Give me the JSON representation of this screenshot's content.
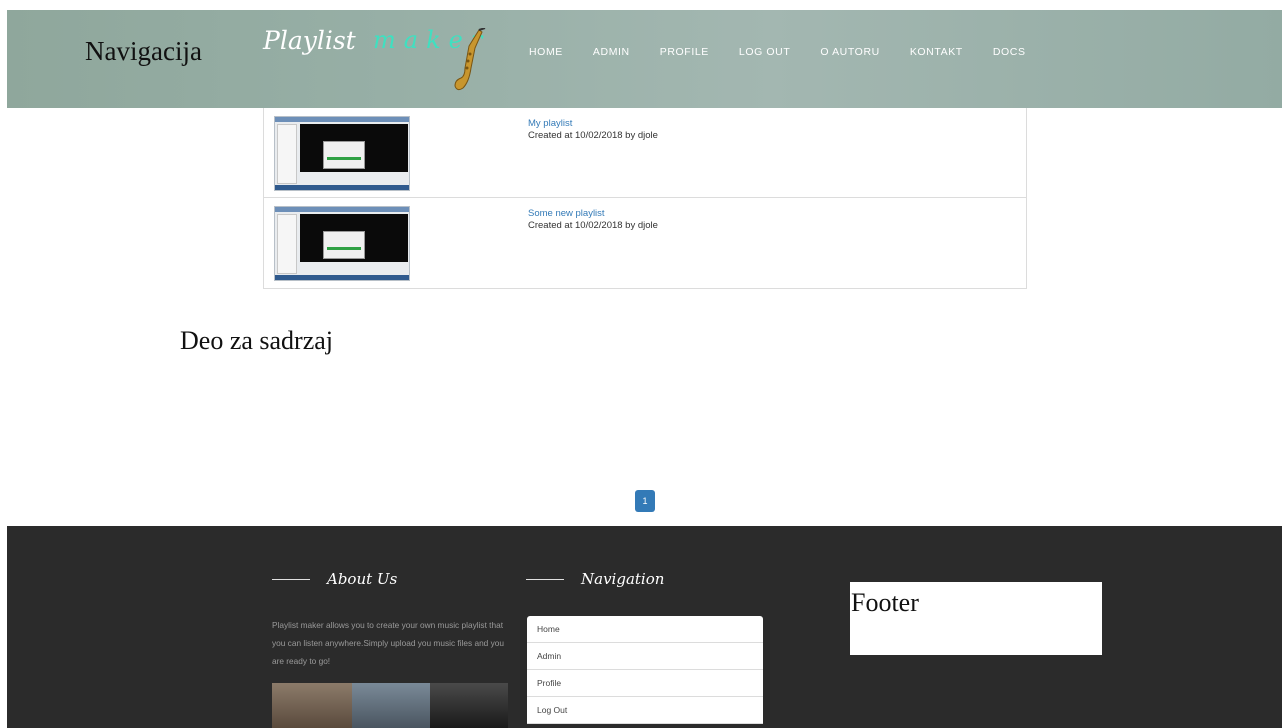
{
  "header": {
    "annotation": "Navigacija",
    "logo": {
      "part1": "Playlist",
      "part2": "maker"
    },
    "nav": [
      "HOME",
      "ADMIN",
      "PROFILE",
      "LOG OUT",
      "O AUTORU",
      "KONTAKT",
      "DOCS"
    ]
  },
  "playlists": [
    {
      "title": "My playlist",
      "meta": "Created at 10/02/2018 by djole"
    },
    {
      "title": "Some new playlist",
      "meta": "Created at 10/02/2018 by djole"
    }
  ],
  "content_annotation": "Deo za sadrzaj",
  "pagination": {
    "current": "1"
  },
  "footer": {
    "about": {
      "heading": "About Us",
      "text": "Playlist maker allows you to create your own music playlist that you can listen anywhere.Simply upload you music files and you are ready to go!"
    },
    "navigation": {
      "heading": "Navigation",
      "items": [
        "Home",
        "Admin",
        "Profile",
        "Log Out"
      ]
    },
    "annotation": "Footer"
  },
  "colors": {
    "link": "#337ab7",
    "logo_accent": "#3fe0c0",
    "footer_bg": "#2b2b2b"
  },
  "icons": [
    "saxophone-icon"
  ]
}
